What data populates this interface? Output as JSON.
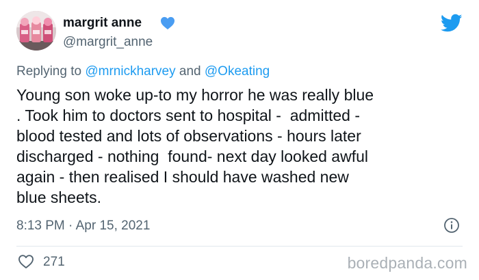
{
  "author": {
    "name": "margrit anne",
    "handle": "@margrit_anne",
    "badge_icon": "blue-heart-icon"
  },
  "platform_icon": "twitter-bird-icon",
  "reply": {
    "prefix": "Replying to",
    "mention_1": "@mrnickharvey",
    "connector": "and",
    "mention_2": "@Okeating"
  },
  "body_lines": [
    "Young son woke up-to my horror he was really blue",
    ". Took him to doctors sent to hospital -  admitted -",
    "blood tested and lots of observations - hours later",
    "discharged - nothing  found- next day looked awful",
    "again - then realised I should have washed new",
    "blue sheets."
  ],
  "timestamp": "8:13 PM · Apr 15, 2021",
  "info_icon": "info-icon",
  "likes": {
    "icon": "heart-outline-icon",
    "count": "271"
  },
  "watermark": "boredpanda.com",
  "colors": {
    "text": "#0f1419",
    "secondary": "#536471",
    "link": "#1d9bf0",
    "twitter_blue": "#1d9bf0",
    "watermark": "#aab0b6"
  }
}
